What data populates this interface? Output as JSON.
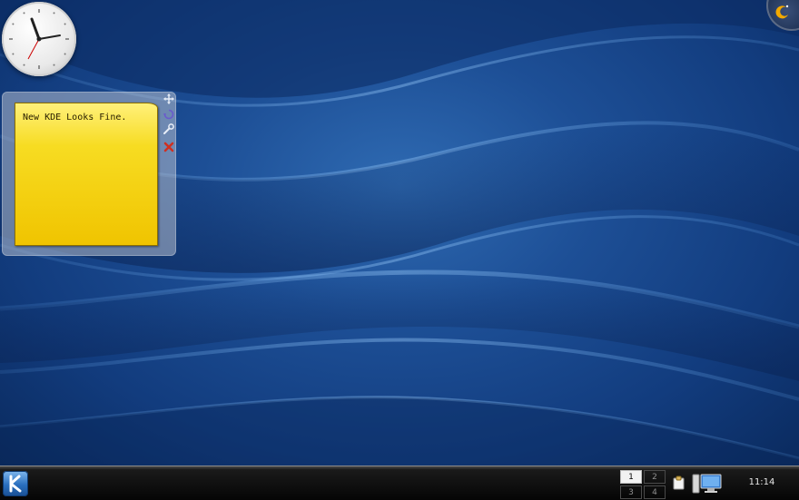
{
  "clock_widget": {
    "time": "11:14"
  },
  "note": {
    "text": "New KDE Looks Fine."
  },
  "note_handles": [
    {
      "name": "move-icon"
    },
    {
      "name": "rotate-icon"
    },
    {
      "name": "configure-icon"
    },
    {
      "name": "remove-icon"
    }
  ],
  "pager": {
    "desktops": [
      "1",
      "2",
      "3",
      "4"
    ],
    "active": "1"
  },
  "panel": {
    "clock": "11:14"
  },
  "colors": {
    "desktop": "#1d4f96",
    "note": "#f7dc22",
    "panel": "#050505",
    "accent": "#2a6fbe",
    "remove": "#d03020"
  }
}
